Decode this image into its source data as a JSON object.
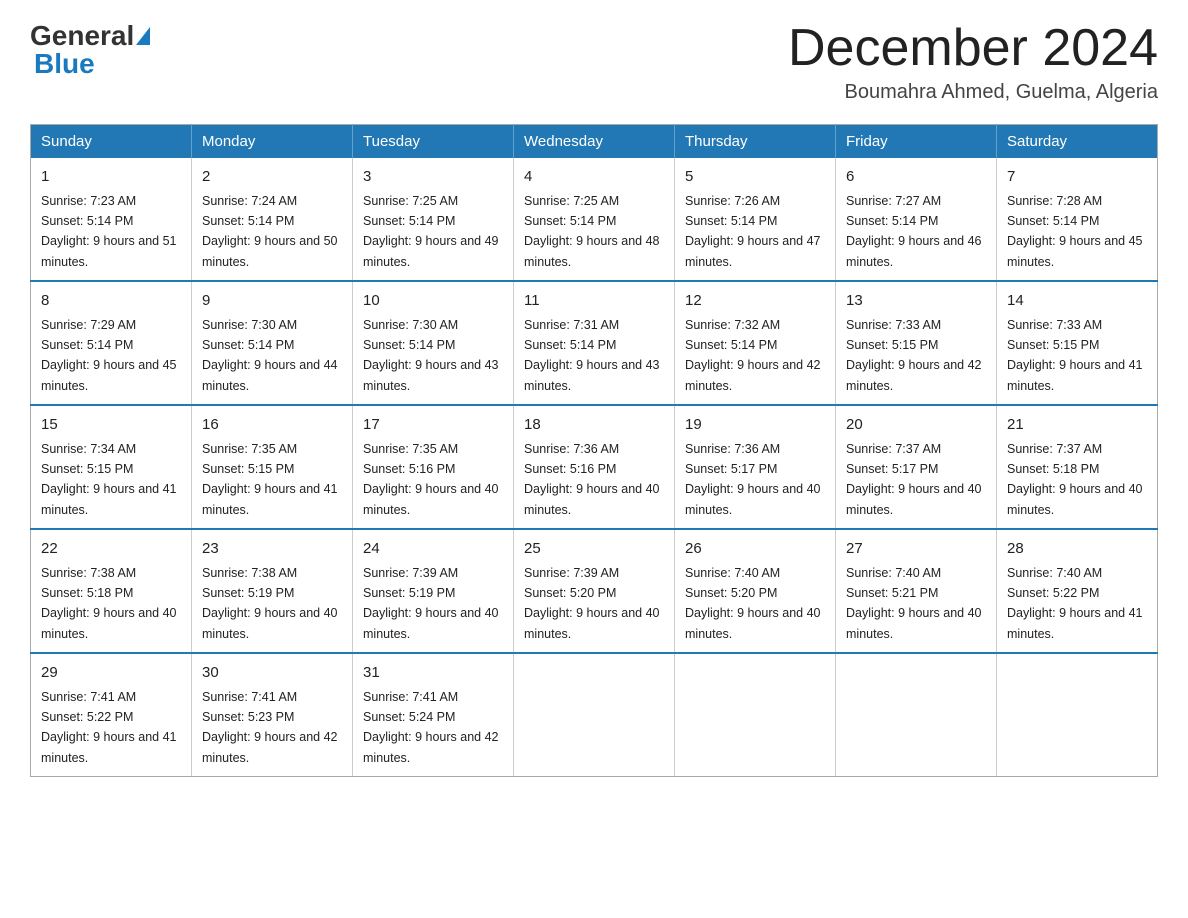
{
  "header": {
    "logo_general": "General",
    "logo_blue": "Blue",
    "month_title": "December 2024",
    "location": "Boumahra Ahmed, Guelma, Algeria"
  },
  "weekdays": [
    "Sunday",
    "Monday",
    "Tuesday",
    "Wednesday",
    "Thursday",
    "Friday",
    "Saturday"
  ],
  "weeks": [
    [
      {
        "day": "1",
        "sunrise": "7:23 AM",
        "sunset": "5:14 PM",
        "daylight": "9 hours and 51 minutes."
      },
      {
        "day": "2",
        "sunrise": "7:24 AM",
        "sunset": "5:14 PM",
        "daylight": "9 hours and 50 minutes."
      },
      {
        "day": "3",
        "sunrise": "7:25 AM",
        "sunset": "5:14 PM",
        "daylight": "9 hours and 49 minutes."
      },
      {
        "day": "4",
        "sunrise": "7:25 AM",
        "sunset": "5:14 PM",
        "daylight": "9 hours and 48 minutes."
      },
      {
        "day": "5",
        "sunrise": "7:26 AM",
        "sunset": "5:14 PM",
        "daylight": "9 hours and 47 minutes."
      },
      {
        "day": "6",
        "sunrise": "7:27 AM",
        "sunset": "5:14 PM",
        "daylight": "9 hours and 46 minutes."
      },
      {
        "day": "7",
        "sunrise": "7:28 AM",
        "sunset": "5:14 PM",
        "daylight": "9 hours and 45 minutes."
      }
    ],
    [
      {
        "day": "8",
        "sunrise": "7:29 AM",
        "sunset": "5:14 PM",
        "daylight": "9 hours and 45 minutes."
      },
      {
        "day": "9",
        "sunrise": "7:30 AM",
        "sunset": "5:14 PM",
        "daylight": "9 hours and 44 minutes."
      },
      {
        "day": "10",
        "sunrise": "7:30 AM",
        "sunset": "5:14 PM",
        "daylight": "9 hours and 43 minutes."
      },
      {
        "day": "11",
        "sunrise": "7:31 AM",
        "sunset": "5:14 PM",
        "daylight": "9 hours and 43 minutes."
      },
      {
        "day": "12",
        "sunrise": "7:32 AM",
        "sunset": "5:14 PM",
        "daylight": "9 hours and 42 minutes."
      },
      {
        "day": "13",
        "sunrise": "7:33 AM",
        "sunset": "5:15 PM",
        "daylight": "9 hours and 42 minutes."
      },
      {
        "day": "14",
        "sunrise": "7:33 AM",
        "sunset": "5:15 PM",
        "daylight": "9 hours and 41 minutes."
      }
    ],
    [
      {
        "day": "15",
        "sunrise": "7:34 AM",
        "sunset": "5:15 PM",
        "daylight": "9 hours and 41 minutes."
      },
      {
        "day": "16",
        "sunrise": "7:35 AM",
        "sunset": "5:15 PM",
        "daylight": "9 hours and 41 minutes."
      },
      {
        "day": "17",
        "sunrise": "7:35 AM",
        "sunset": "5:16 PM",
        "daylight": "9 hours and 40 minutes."
      },
      {
        "day": "18",
        "sunrise": "7:36 AM",
        "sunset": "5:16 PM",
        "daylight": "9 hours and 40 minutes."
      },
      {
        "day": "19",
        "sunrise": "7:36 AM",
        "sunset": "5:17 PM",
        "daylight": "9 hours and 40 minutes."
      },
      {
        "day": "20",
        "sunrise": "7:37 AM",
        "sunset": "5:17 PM",
        "daylight": "9 hours and 40 minutes."
      },
      {
        "day": "21",
        "sunrise": "7:37 AM",
        "sunset": "5:18 PM",
        "daylight": "9 hours and 40 minutes."
      }
    ],
    [
      {
        "day": "22",
        "sunrise": "7:38 AM",
        "sunset": "5:18 PM",
        "daylight": "9 hours and 40 minutes."
      },
      {
        "day": "23",
        "sunrise": "7:38 AM",
        "sunset": "5:19 PM",
        "daylight": "9 hours and 40 minutes."
      },
      {
        "day": "24",
        "sunrise": "7:39 AM",
        "sunset": "5:19 PM",
        "daylight": "9 hours and 40 minutes."
      },
      {
        "day": "25",
        "sunrise": "7:39 AM",
        "sunset": "5:20 PM",
        "daylight": "9 hours and 40 minutes."
      },
      {
        "day": "26",
        "sunrise": "7:40 AM",
        "sunset": "5:20 PM",
        "daylight": "9 hours and 40 minutes."
      },
      {
        "day": "27",
        "sunrise": "7:40 AM",
        "sunset": "5:21 PM",
        "daylight": "9 hours and 40 minutes."
      },
      {
        "day": "28",
        "sunrise": "7:40 AM",
        "sunset": "5:22 PM",
        "daylight": "9 hours and 41 minutes."
      }
    ],
    [
      {
        "day": "29",
        "sunrise": "7:41 AM",
        "sunset": "5:22 PM",
        "daylight": "9 hours and 41 minutes."
      },
      {
        "day": "30",
        "sunrise": "7:41 AM",
        "sunset": "5:23 PM",
        "daylight": "9 hours and 42 minutes."
      },
      {
        "day": "31",
        "sunrise": "7:41 AM",
        "sunset": "5:24 PM",
        "daylight": "9 hours and 42 minutes."
      },
      null,
      null,
      null,
      null
    ]
  ]
}
